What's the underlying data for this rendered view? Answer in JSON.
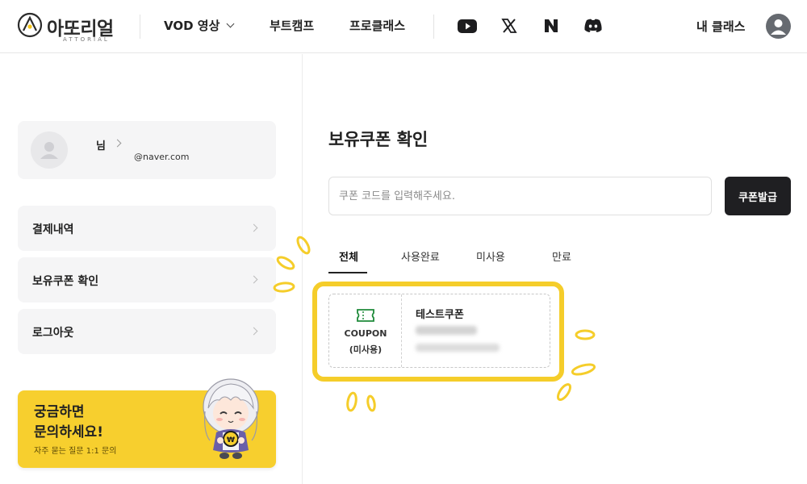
{
  "header": {
    "logo_text": "아또리얼",
    "logo_sub": "ATTORIAL",
    "nav": [
      {
        "label": "VOD 영상"
      },
      {
        "label": "부트캠프"
      },
      {
        "label": "프로클래스"
      }
    ],
    "social_icons": [
      "youtube-icon",
      "x-icon",
      "naver-icon",
      "discord-icon"
    ],
    "my_class_label": "내 클래스"
  },
  "sidebar": {
    "profile": {
      "name": "님",
      "email": "@naver.com"
    },
    "menu": [
      {
        "label": "결제내역"
      },
      {
        "label": "보유쿠폰 확인"
      },
      {
        "label": "로그아웃"
      }
    ],
    "help": {
      "title": "궁금하면\n문의하세요!",
      "subtitle": "자주 묻는 질문 1:1 문의"
    }
  },
  "main": {
    "title": "보유쿠폰 확인",
    "coupon_input": {
      "placeholder": "쿠폰 코드를 입력해주세요.",
      "value": ""
    },
    "issue_button": "쿠폰발급",
    "tabs": [
      {
        "label": "전체",
        "active": true
      },
      {
        "label": "사용완료",
        "active": false
      },
      {
        "label": "미사용",
        "active": false
      },
      {
        "label": "만료",
        "active": false
      }
    ],
    "coupon": {
      "badge": "COUPON",
      "status": "(미사용)",
      "name": "테스트쿠폰"
    }
  },
  "colors": {
    "accent_yellow": "#f7cf2e",
    "dark_button": "#1f1f22",
    "coupon_icon_green": "#1e8a3a"
  }
}
